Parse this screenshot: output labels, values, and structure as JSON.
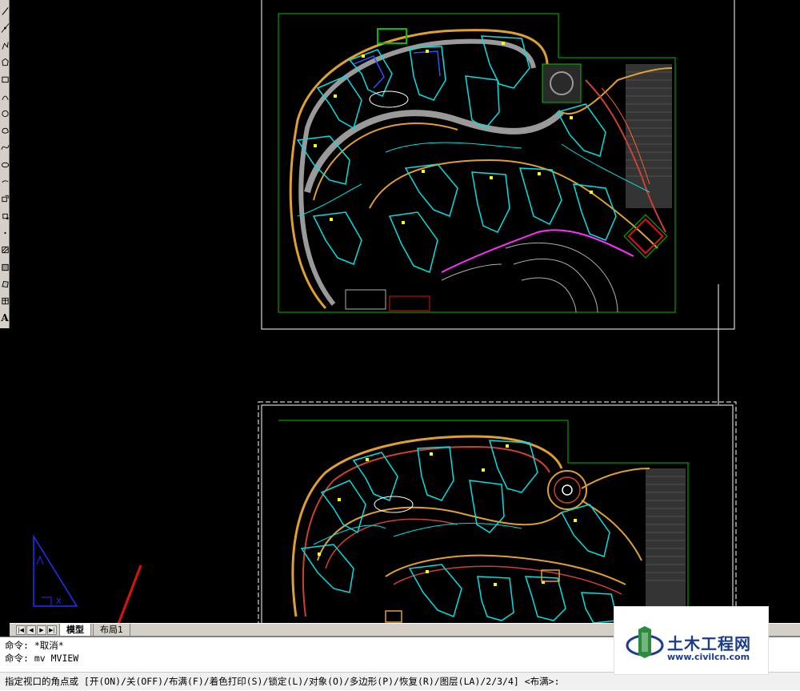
{
  "colors": {
    "canvas_bg": "#000000",
    "sheet_border": "#ffffff",
    "viewport_frame": "#00c000",
    "road_orange": "#e0a030",
    "road_gray": "#9a9a9a",
    "building_cyan": "#00e0e0",
    "building_blue": "#3050ff",
    "accent_yellow": "#ffff00",
    "landscape_magenta": "#ff30ff",
    "ucs_blue": "#2030ff",
    "annotation_red": "#e01010"
  },
  "toolbar": {
    "tools": [
      {
        "icon": "line-icon"
      },
      {
        "icon": "construction-line-icon"
      },
      {
        "icon": "polyline-icon"
      },
      {
        "icon": "polygon-icon"
      },
      {
        "icon": "rectangle-icon"
      },
      {
        "icon": "arc-icon"
      },
      {
        "icon": "circle-icon"
      },
      {
        "icon": "revision-cloud-icon"
      },
      {
        "icon": "spline-icon"
      },
      {
        "icon": "ellipse-icon"
      },
      {
        "icon": "ellipse-arc-icon"
      },
      {
        "icon": "insert-block-icon"
      },
      {
        "icon": "make-block-icon"
      },
      {
        "icon": "point-icon"
      },
      {
        "icon": "hatch-icon"
      },
      {
        "icon": "gradient-icon"
      },
      {
        "icon": "region-icon"
      },
      {
        "icon": "table-icon"
      },
      {
        "icon": "multiline-text-icon"
      }
    ],
    "text_tool_glyph": "A"
  },
  "tabs": {
    "items": [
      {
        "label": "模型",
        "active": true
      },
      {
        "label": "布局1",
        "active": false
      }
    ]
  },
  "command": {
    "history": [
      "命令: *取消*",
      "命令: mv MVIEW"
    ],
    "prompt": "指定视口的角点或 [开(ON)/关(OFF)/布满(F)/着色打印(S)/锁定(L)/对象(O)/多边形(P)/恢复(R)/图层(LA)/2/3/4] <布满>:"
  },
  "watermark": {
    "title": "土木工程网",
    "url": "www.civilcn.com"
  }
}
